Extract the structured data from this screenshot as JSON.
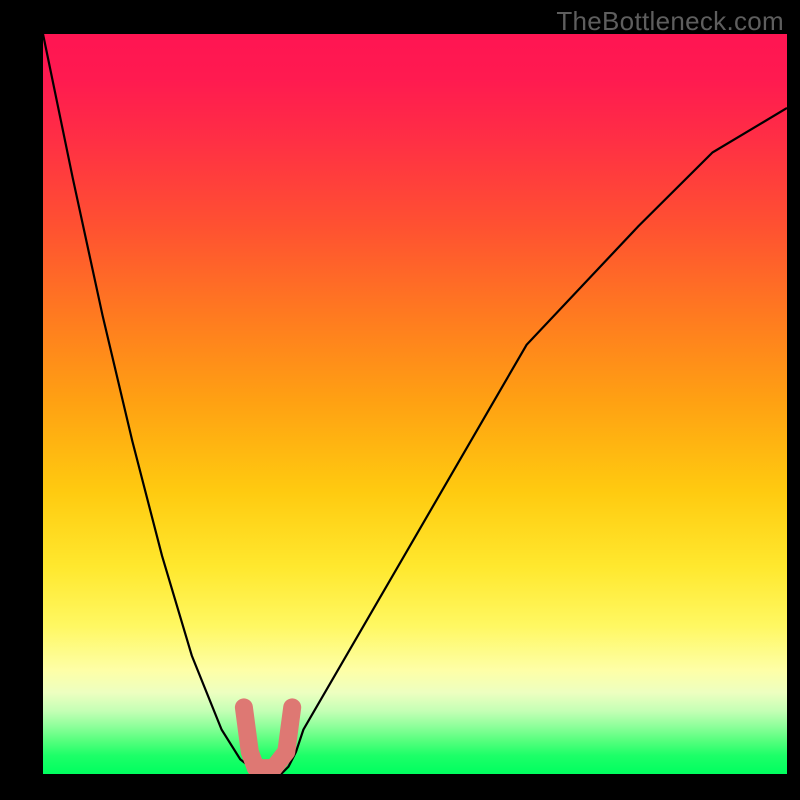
{
  "watermark": "TheBottleneck.com",
  "colors": {
    "frame": "#000000",
    "watermark_text": "#5e5e5e",
    "curve": "#000000",
    "marker": "#de7873",
    "gradient_top": "#ff1552",
    "gradient_bottom": "#00ff5f"
  },
  "chart_data": {
    "type": "line",
    "title": "",
    "xlabel": "",
    "ylabel": "",
    "xlim": [
      0,
      100
    ],
    "ylim": [
      0,
      100
    ],
    "x": [
      0,
      4,
      8,
      12,
      16,
      20,
      24,
      26.5,
      29,
      30.5,
      32,
      33,
      34,
      35,
      65,
      80,
      90,
      100
    ],
    "y": [
      100,
      80.5,
      62,
      45,
      29.5,
      16,
      6,
      2,
      0,
      0,
      0,
      1,
      3,
      6,
      58,
      74,
      84,
      90
    ],
    "series": [
      {
        "name": "bottleneck-curve",
        "x_key": "x",
        "y_key": "y"
      }
    ],
    "marker_segment": {
      "note": "highlighted L-shaped marker near curve minimum",
      "points": [
        {
          "x": 27.0,
          "y": 9.0
        },
        {
          "x": 27.8,
          "y": 3.0
        },
        {
          "x": 28.6,
          "y": 0.8
        },
        {
          "x": 31.0,
          "y": 0.8
        },
        {
          "x": 32.7,
          "y": 3.0
        },
        {
          "x": 33.5,
          "y": 9.0
        }
      ]
    },
    "gradient_stops": [
      {
        "pos": 0.0,
        "color": "#ff1552"
      },
      {
        "pos": 0.26,
        "color": "#ff5131"
      },
      {
        "pos": 0.5,
        "color": "#ffa212"
      },
      {
        "pos": 0.72,
        "color": "#ffe82e"
      },
      {
        "pos": 0.86,
        "color": "#feffa7"
      },
      {
        "pos": 1.0,
        "color": "#00ff5f"
      }
    ]
  }
}
